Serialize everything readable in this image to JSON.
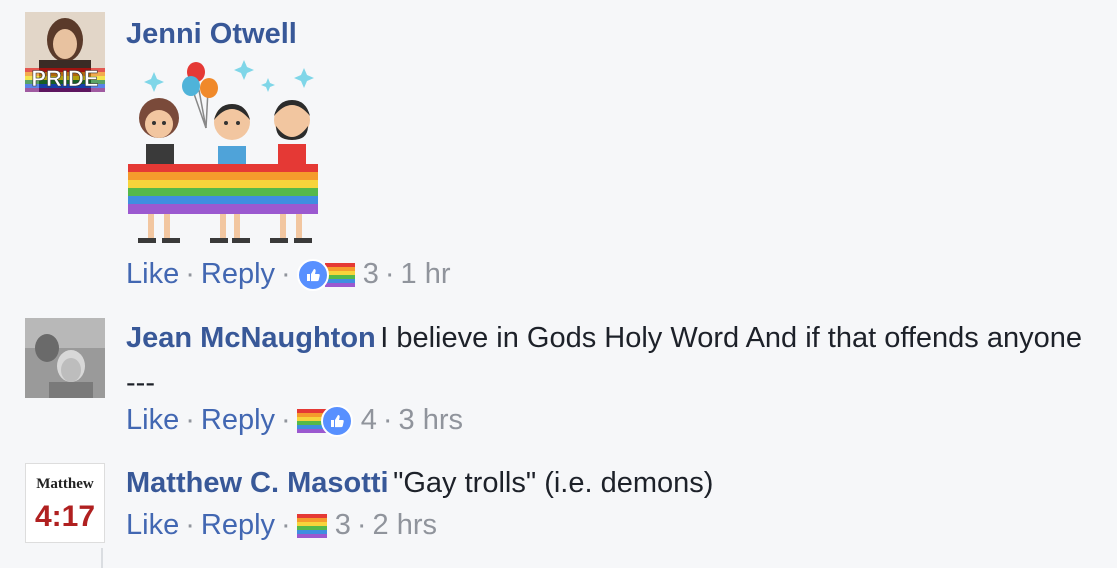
{
  "comments": [
    {
      "author": "Jenni Otwell",
      "text": "",
      "has_sticker": true,
      "avatar_text": "PRIDE",
      "actions": {
        "like": "Like",
        "reply": "Reply",
        "reaction_count": "3",
        "time": "1 hr"
      },
      "reactions": [
        "like-icon",
        "pride-flag-icon"
      ]
    },
    {
      "author": "Jean McNaughton",
      "text": "I believe in Gods Holy Word And if that offends anyone ---",
      "actions": {
        "like": "Like",
        "reply": "Reply",
        "reaction_count": "4",
        "time": "3 hrs"
      },
      "reactions": [
        "pride-flag-icon",
        "like-icon"
      ]
    },
    {
      "author": "Matthew C. Masotti",
      "text": "\"Gay trolls\" (i.e. demons)",
      "avatar_text": {
        "name": "Matthew",
        "verse": "4:17"
      },
      "actions": {
        "like": "Like",
        "reply": "Reply",
        "reaction_count": "3",
        "time": "2 hrs"
      },
      "reactions": [
        "pride-flag-icon"
      ]
    }
  ],
  "separator": "·",
  "colors": {
    "author": "#385898",
    "link": "#4267b2",
    "meta": "#90949c",
    "like": "#5890ff",
    "background": "#f6f7f9"
  }
}
